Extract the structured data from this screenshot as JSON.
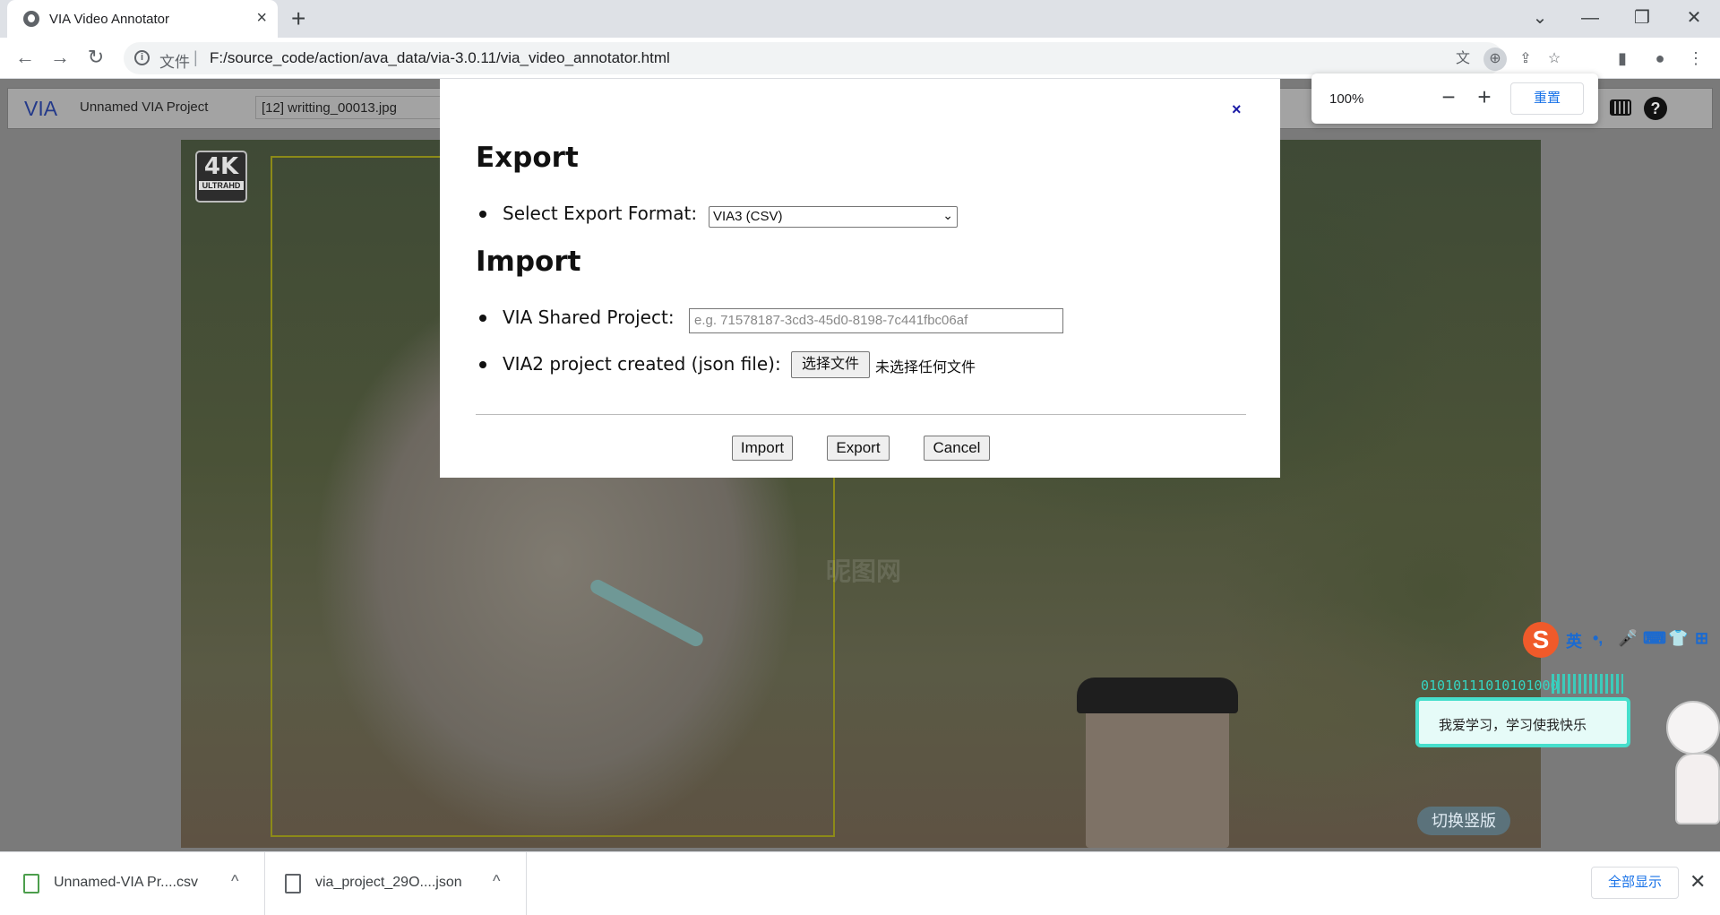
{
  "browser": {
    "tab_title": "VIA Video Annotator",
    "tab_close": "×",
    "new_tab": "+",
    "window_controls": [
      "⌄",
      "—",
      "❐",
      "✕"
    ],
    "scheme_label": "文件",
    "separator": "|",
    "url": "F:/source_code/action/ava_data/via-3.0.11/via_video_annotator.html"
  },
  "zoom_popup": {
    "level": "100%",
    "minus": "−",
    "plus": "+",
    "reset_label": "重置"
  },
  "via": {
    "logo": "VIA",
    "project_name": "Unnamed VIA Project",
    "file_selector": "[12] writting_00013.jpg",
    "help": "?"
  },
  "video": {
    "badge_big": "4K",
    "badge_small": "ULTRAHD",
    "watermark": "昵图网"
  },
  "modal": {
    "close": "×",
    "export_heading": "Export",
    "export_format_label": "Select Export Format:",
    "export_format_value": "VIA3 (CSV)",
    "import_heading": "Import",
    "shared_project_label": "VIA Shared Project:",
    "shared_project_placeholder": "e.g. 71578187-3cd3-45d0-8198-7c441fbc06af",
    "via2_label": "VIA2 project created (json file):",
    "choose_file": "选择文件",
    "no_file": "未选择任何文件",
    "buttons": {
      "import": "Import",
      "export": "Export",
      "cancel": "Cancel"
    }
  },
  "ime": {
    "logo": "S",
    "items": [
      "英",
      "•,",
      "🎤",
      "⌨",
      "👕",
      "⊞"
    ],
    "code_text": "01010111010101000",
    "bubble_text": "我爱学习，学习使我快乐",
    "switch_label": "切换竖版"
  },
  "downloads": {
    "items": [
      {
        "name": "Unnamed-VIA Pr....csv"
      },
      {
        "name": "via_project_29O....json"
      }
    ],
    "chevron": "^",
    "show_all": "全部显示",
    "close": "✕"
  }
}
